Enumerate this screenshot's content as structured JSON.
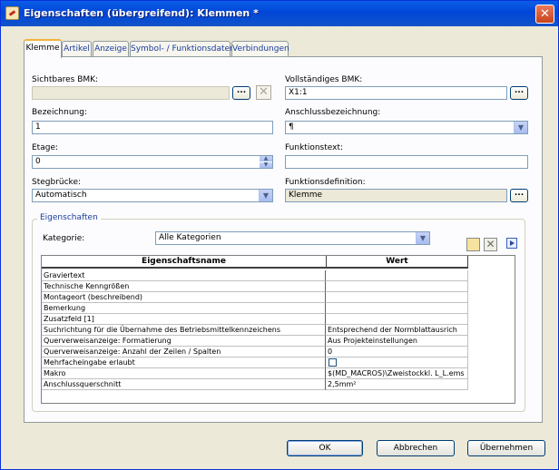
{
  "window": {
    "title": "Eigenschaften (übergreifend): Klemmen *"
  },
  "tabs": [
    "Klemme",
    "Artikel",
    "Anzeige",
    "Symbol- / Funktionsdaten",
    "Verbindungen"
  ],
  "fields": {
    "sichtbares_bmk": {
      "label": "Sichtbares BMK:",
      "value": ""
    },
    "vollstaendiges_bmk": {
      "label": "Vollständiges BMK:",
      "value": "X1:1"
    },
    "bezeichnung": {
      "label": "Bezeichnung:",
      "value": "1"
    },
    "anschlussbezeichnung": {
      "label": "Anschlussbezeichnung:",
      "value": "¶"
    },
    "etage": {
      "label": "Etage:",
      "value": "0"
    },
    "funktionstext": {
      "label": "Funktionstext:",
      "value": ""
    },
    "stegbruecke": {
      "label": "Stegbrücke:",
      "value": "Automatisch"
    },
    "funktionsdefinition": {
      "label": "Funktionsdefinition:",
      "value": "Klemme"
    }
  },
  "dots_label": "...",
  "properties": {
    "group_title": "Eigenschaften",
    "category_label": "Kategorie:",
    "category_value": "Alle Kategorien",
    "columns": [
      "Eigenschaftsname",
      "Wert"
    ],
    "rows": [
      {
        "name": "Graviertext",
        "value": ""
      },
      {
        "name": "Technische Kenngrößen",
        "value": ""
      },
      {
        "name": "Montageort (beschreibend)",
        "value": ""
      },
      {
        "name": "Bemerkung",
        "value": ""
      },
      {
        "name": "Zusatzfeld [1]",
        "value": ""
      },
      {
        "name": "Suchrichtung für die Übernahme des Betriebsmittelkennzeichens",
        "value": "Entsprechend der Normblattausrich"
      },
      {
        "name": "Querverweisanzeige: Formatierung",
        "value": "Aus Projekteinstellungen"
      },
      {
        "name": "Querverweisanzeige: Anzahl der Zeilen / Spalten",
        "value": "0"
      },
      {
        "name": "Mehrfacheingabe erlaubt",
        "value": "",
        "checkbox": true
      },
      {
        "name": "Makro",
        "value": "$(MD_MACROS)\\Zweistockkl. L_L.ems"
      },
      {
        "name": "Anschlussquerschnitt",
        "value": "2,5mm²"
      }
    ]
  },
  "buttons": {
    "ok": "OK",
    "cancel": "Abbrechen",
    "apply": "Übernehmen"
  },
  "colors": {
    "titlebar": "#0a5ee6",
    "dialog_bg": "#ece9d8",
    "tab_active_accent": "#f3b33a"
  }
}
